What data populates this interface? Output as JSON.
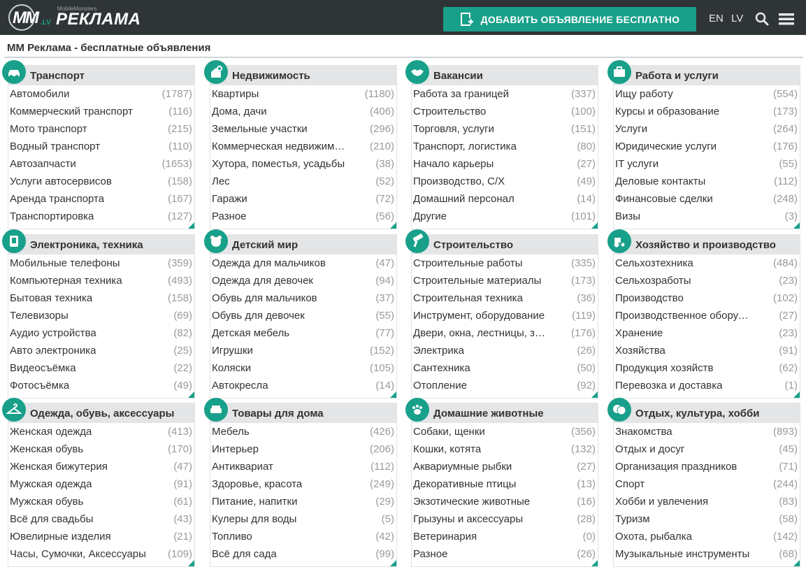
{
  "header": {
    "logo": {
      "mm": "MM",
      "lv": ".LV",
      "sub": "MobileMonsters",
      "brand": "РЕКЛАМА"
    },
    "add_button": "ДОБАВИТЬ ОБЪЯВЛЕНИЕ БЕСПЛАТНО",
    "langs": [
      "EN",
      "LV"
    ],
    "icons": {
      "search": "search-icon",
      "menu": "hamburger-menu-icon",
      "add": "add-document-icon"
    }
  },
  "page_title": "MM Реклама - бесплатные объявления",
  "colors": {
    "accent": "#18a08a",
    "header_bg": "#2f3437",
    "category_header_bg": "#e3e5e6",
    "count": "#9a9a9a"
  },
  "categories": [
    {
      "title": "Транспорт",
      "icon": "car-icon",
      "items": [
        {
          "name": "Автомобили",
          "count": "(1787)"
        },
        {
          "name": "Коммерческий транспорт",
          "count": "(116)"
        },
        {
          "name": "Мото транспорт",
          "count": "(215)"
        },
        {
          "name": "Водный транспорт",
          "count": "(110)"
        },
        {
          "name": "Автозапчасти",
          "count": "(1653)"
        },
        {
          "name": "Услуги автосервисов",
          "count": "(158)"
        },
        {
          "name": "Аренда транспорта",
          "count": "(167)"
        },
        {
          "name": "Транспортировка",
          "count": "(127)"
        }
      ]
    },
    {
      "title": "Недвижимость",
      "icon": "house-key-icon",
      "items": [
        {
          "name": "Квартиры",
          "count": "(1180)"
        },
        {
          "name": "Дома, дачи",
          "count": "(406)"
        },
        {
          "name": "Земельные участки",
          "count": "(296)"
        },
        {
          "name": "Коммерческая недвижимость",
          "count": "(210)"
        },
        {
          "name": "Хутора, поместья, усадьбы",
          "count": "(38)"
        },
        {
          "name": "Лес",
          "count": "(52)"
        },
        {
          "name": "Гаражи",
          "count": "(72)"
        },
        {
          "name": "Разное",
          "count": "(56)"
        }
      ]
    },
    {
      "title": "Вакансии",
      "icon": "handshake-icon",
      "items": [
        {
          "name": "Работа за границей",
          "count": "(337)"
        },
        {
          "name": "Строительство",
          "count": "(100)"
        },
        {
          "name": "Торговля, услуги",
          "count": "(151)"
        },
        {
          "name": "Транспорт, логистика",
          "count": "(80)"
        },
        {
          "name": "Начало карьеры",
          "count": "(27)"
        },
        {
          "name": "Производство, С/Х",
          "count": "(49)"
        },
        {
          "name": "Домашний персонал",
          "count": "(14)"
        },
        {
          "name": "Другие",
          "count": "(101)"
        }
      ]
    },
    {
      "title": "Работа и услуги",
      "icon": "briefcase-icon",
      "items": [
        {
          "name": "Ищу работу",
          "count": "(554)"
        },
        {
          "name": "Курсы и образование",
          "count": "(173)"
        },
        {
          "name": "Услуги",
          "count": "(264)"
        },
        {
          "name": "Юридические услуги",
          "count": "(176)"
        },
        {
          "name": "IT услуги",
          "count": "(55)"
        },
        {
          "name": "Деловые контакты",
          "count": "(112)"
        },
        {
          "name": "Финансовые сделки",
          "count": "(248)"
        },
        {
          "name": "Визы",
          "count": "(3)"
        }
      ]
    },
    {
      "title": "Электроника, техника",
      "icon": "electronics-icon",
      "items": [
        {
          "name": "Мобильные телефоны",
          "count": "(359)"
        },
        {
          "name": "Компьютерная техника",
          "count": "(493)"
        },
        {
          "name": "Бытовая техника",
          "count": "(158)"
        },
        {
          "name": "Телевизоры",
          "count": "(69)"
        },
        {
          "name": "Аудио устройства",
          "count": "(82)"
        },
        {
          "name": "Авто электроника",
          "count": "(25)"
        },
        {
          "name": "Видеосъёмка",
          "count": "(22)"
        },
        {
          "name": "Фотосъёмка",
          "count": "(49)"
        }
      ]
    },
    {
      "title": "Детский мир",
      "icon": "teddy-bear-icon",
      "items": [
        {
          "name": "Одежда для мальчиков",
          "count": "(47)"
        },
        {
          "name": "Одежда для девочек",
          "count": "(94)"
        },
        {
          "name": "Обувь для мальчиков",
          "count": "(37)"
        },
        {
          "name": "Обувь для девочек",
          "count": "(55)"
        },
        {
          "name": "Детская мебель",
          "count": "(77)"
        },
        {
          "name": "Игрушки",
          "count": "(152)"
        },
        {
          "name": "Коляски",
          "count": "(105)"
        },
        {
          "name": "Автокресла",
          "count": "(14)"
        }
      ]
    },
    {
      "title": "Строительство",
      "icon": "paint-roller-icon",
      "items": [
        {
          "name": "Строительные работы",
          "count": "(335)"
        },
        {
          "name": "Строительные материалы",
          "count": "(173)"
        },
        {
          "name": "Строительная техника",
          "count": "(36)"
        },
        {
          "name": "Инструмент, оборудование",
          "count": "(119)"
        },
        {
          "name": "Двери, окна, лестницы, заб...",
          "count": "(176)"
        },
        {
          "name": "Электрика",
          "count": "(26)"
        },
        {
          "name": "Сантехника",
          "count": "(50)"
        },
        {
          "name": "Отопление",
          "count": "(92)"
        }
      ]
    },
    {
      "title": "Хозяйство и производство",
      "icon": "tractor-icon",
      "items": [
        {
          "name": "Сельхозтехника",
          "count": "(484)"
        },
        {
          "name": "Сельхозработы",
          "count": "(23)"
        },
        {
          "name": "Производство",
          "count": "(102)"
        },
        {
          "name": "Производственное оборудо...",
          "count": "(27)"
        },
        {
          "name": "Хранение",
          "count": "(23)"
        },
        {
          "name": "Хозяйства",
          "count": "(91)"
        },
        {
          "name": "Продукция хозяйств",
          "count": "(62)"
        },
        {
          "name": "Перевозка и доставка",
          "count": "(1)"
        }
      ]
    },
    {
      "title": "Одежда, обувь, аксессуары",
      "icon": "clothes-hanger-icon",
      "items": [
        {
          "name": "Женская одежда",
          "count": "(413)"
        },
        {
          "name": "Женская обувь",
          "count": "(170)"
        },
        {
          "name": "Женская бижутерия",
          "count": "(47)"
        },
        {
          "name": "Мужская одежда",
          "count": "(91)"
        },
        {
          "name": "Мужская обувь",
          "count": "(61)"
        },
        {
          "name": "Всё для свадьбы",
          "count": "(43)"
        },
        {
          "name": "Ювелирные изделия",
          "count": "(21)"
        },
        {
          "name": "Часы, Сумочки, Аксессуары",
          "count": "(109)"
        }
      ]
    },
    {
      "title": "Товары для дома",
      "icon": "sofa-icon",
      "items": [
        {
          "name": "Мебель",
          "count": "(426)"
        },
        {
          "name": "Интерьер",
          "count": "(206)"
        },
        {
          "name": "Антиквариат",
          "count": "(112)"
        },
        {
          "name": "Здоровье, красота",
          "count": "(249)"
        },
        {
          "name": "Питание, напитки",
          "count": "(29)"
        },
        {
          "name": "Кулеры для воды",
          "count": "(5)"
        },
        {
          "name": "Топливо",
          "count": "(42)"
        },
        {
          "name": "Всё для сада",
          "count": "(99)"
        }
      ]
    },
    {
      "title": "Домашние животные",
      "icon": "pets-icon",
      "items": [
        {
          "name": "Собаки, щенки",
          "count": "(356)"
        },
        {
          "name": "Кошки, котята",
          "count": "(132)"
        },
        {
          "name": "Аквариумные рыбки",
          "count": "(27)"
        },
        {
          "name": "Декоративные птицы",
          "count": "(13)"
        },
        {
          "name": "Экзотические животные",
          "count": "(16)"
        },
        {
          "name": "Грызуны и аксессуары",
          "count": "(28)"
        },
        {
          "name": "Ветеринария",
          "count": "(0)"
        },
        {
          "name": "Разное",
          "count": "(26)"
        }
      ]
    },
    {
      "title": "Отдых, культура, хобби",
      "icon": "theater-masks-icon",
      "items": [
        {
          "name": "Знакомства",
          "count": "(893)"
        },
        {
          "name": "Отдых и досуг",
          "count": "(45)"
        },
        {
          "name": "Организация праздников",
          "count": "(71)"
        },
        {
          "name": "Спорт",
          "count": "(244)"
        },
        {
          "name": "Хобби и увлечения",
          "count": "(83)"
        },
        {
          "name": "Туризм",
          "count": "(58)"
        },
        {
          "name": "Охота, рыбалка",
          "count": "(142)"
        },
        {
          "name": "Музыкальные инструменты",
          "count": "(68)"
        }
      ]
    }
  ]
}
